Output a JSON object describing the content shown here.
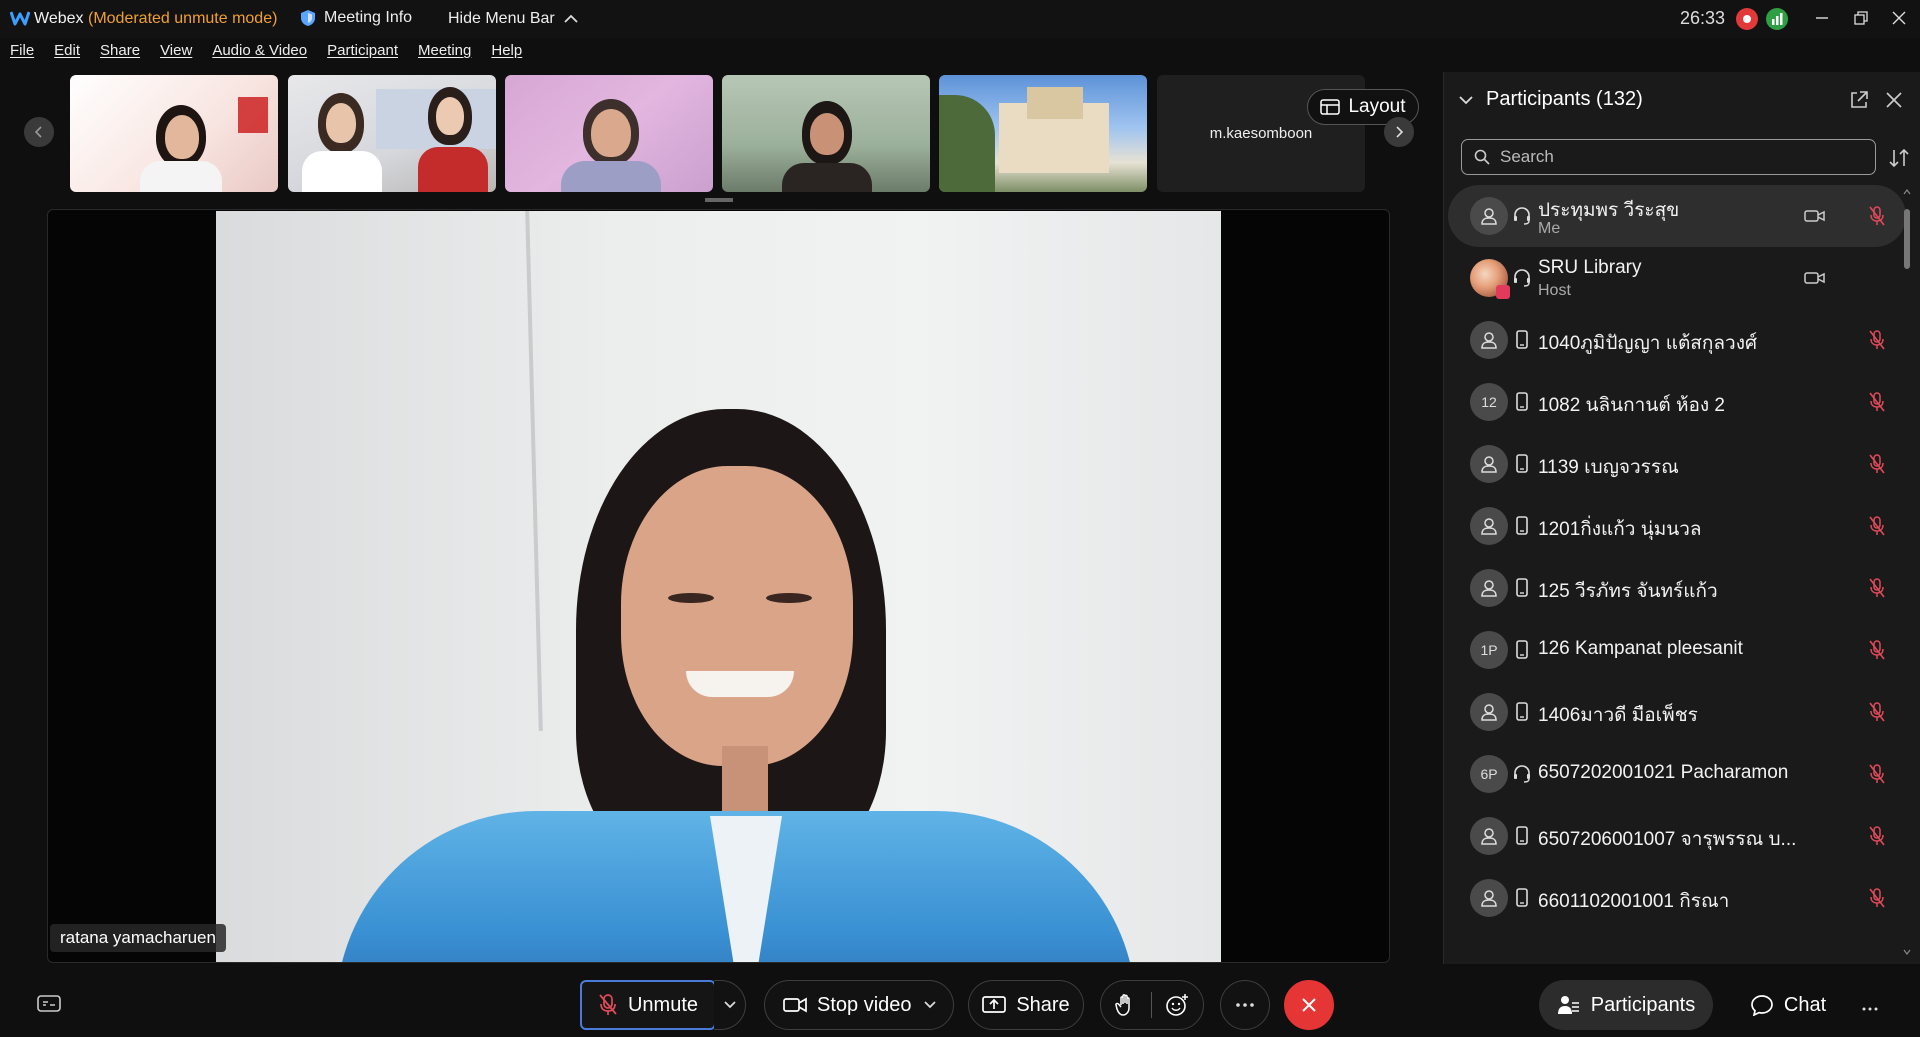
{
  "window": {
    "app_name": "Webex",
    "mode": "(Moderated unmute mode)",
    "meeting_info": "Meeting Info",
    "hide_menu": "Hide Menu Bar",
    "timer": "26:33",
    "colors": {
      "mode": "#f0a030",
      "recording": "#e23a3a",
      "stats": "#2ea043"
    }
  },
  "menu": [
    "File",
    "Edit",
    "Share",
    "View",
    "Audio & Video",
    "Participant",
    "Meeting",
    "Help"
  ],
  "filmstrip": {
    "tile_name": "m.kaesomboon",
    "layout_label": "Layout"
  },
  "stage": {
    "speaker_name": "ratana yamacharuen"
  },
  "controls": {
    "unmute": "Unmute",
    "stop_video": "Stop video",
    "share": "Share",
    "end_color": "#e53535"
  },
  "panel_tabs": {
    "participants": "Participants",
    "chat": "Chat"
  },
  "participants_panel": {
    "title": "Participants (132)",
    "search_placeholder": "Search",
    "list": [
      {
        "name": "ประทุมพร วีระสุข",
        "role": "Me",
        "avatar": "person-icon",
        "conn": "headset-icon",
        "video": true,
        "muted": true
      },
      {
        "name": "SRU Library",
        "role": "Host",
        "avatar": "photo",
        "conn": "headset-icon",
        "video": true,
        "muted": false
      },
      {
        "name": "1040ภูมิปัญญา แต้สกุลวงศ์",
        "avatar": "person-icon",
        "conn": "phone-icon",
        "muted": true
      },
      {
        "name": "1082 นลินกานต์ ห้อง 2",
        "initials": "12",
        "conn": "phone-icon",
        "muted": true
      },
      {
        "name": "1139 เบญจวรรณ",
        "avatar": "person-icon",
        "conn": "phone-icon",
        "muted": true
      },
      {
        "name": "1201กิ่งแก้ว นุ่มนวล",
        "avatar": "person-icon",
        "conn": "phone-icon",
        "muted": true
      },
      {
        "name": "125 วีรภัทร จันทร์แก้ว",
        "avatar": "person-icon",
        "conn": "phone-icon",
        "muted": true
      },
      {
        "name": "126 Kampanat pleesanit",
        "initials": "1P",
        "conn": "phone-icon",
        "muted": true
      },
      {
        "name": "1406มาวดี มือเพ็ชร",
        "avatar": "person-icon",
        "conn": "phone-icon",
        "muted": true
      },
      {
        "name": "6507202001021 Pacharamon",
        "initials": "6P",
        "conn": "headset-icon",
        "muted": true
      },
      {
        "name": "6507206001007 จารุพรรณ บ...",
        "avatar": "person-icon",
        "conn": "phone-icon",
        "muted": true
      },
      {
        "name": "6601102001001 กิรณา",
        "avatar": "person-icon",
        "conn": "phone-icon",
        "muted": true
      }
    ]
  }
}
